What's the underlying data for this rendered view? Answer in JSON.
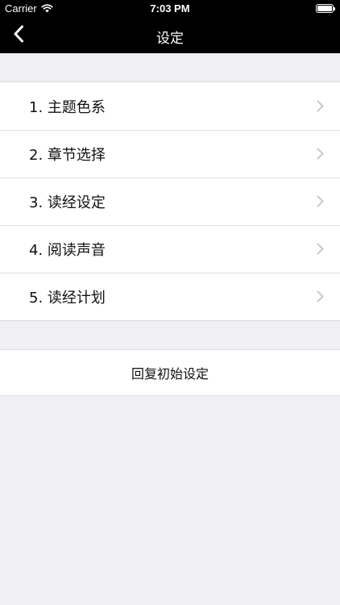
{
  "status_bar": {
    "carrier": "Carrier",
    "time": "7:03 PM",
    "wifi_icon": "wifi-icon",
    "battery_icon": "battery-full-icon"
  },
  "nav": {
    "title": "设定",
    "back_icon": "chevron-left-icon"
  },
  "settings": {
    "items": [
      {
        "label": "1. 主题色系"
      },
      {
        "label": "2. 章节选择"
      },
      {
        "label": "3. 读经设定"
      },
      {
        "label": "4. 阅读声音"
      },
      {
        "label": "5. 读经计划"
      }
    ],
    "item_icon": "chevron-right-icon"
  },
  "reset": {
    "label": "回复初始设定"
  },
  "colors": {
    "bar_background": "#000000",
    "page_background": "#efeff4",
    "cell_background": "#ffffff",
    "chevron": "#c7c7cc"
  }
}
